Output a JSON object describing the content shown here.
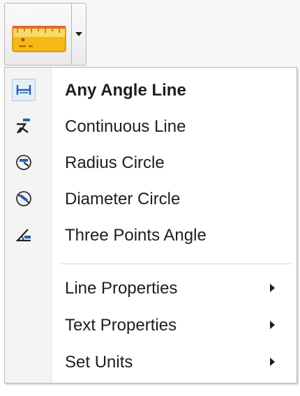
{
  "toolbar": {
    "tool_icon": "ruler-icon",
    "dropdown_icon": "chevron-down-icon"
  },
  "menu": {
    "items": [
      {
        "label": "Any Angle Line",
        "icon": "any-angle-line-icon",
        "selected": true
      },
      {
        "label": "Continuous Line",
        "icon": "continuous-line-icon"
      },
      {
        "label": "Radius Circle",
        "icon": "radius-circle-icon"
      },
      {
        "label": "Diameter Circle",
        "icon": "diameter-circle-icon"
      },
      {
        "label": "Three Points Angle",
        "icon": "three-points-angle-icon"
      }
    ],
    "submenus": [
      {
        "label": "Line Properties",
        "icon": "submenu-arrow-icon"
      },
      {
        "label": "Text Properties",
        "icon": "submenu-arrow-icon"
      },
      {
        "label": "Set Units",
        "icon": "submenu-arrow-icon"
      }
    ]
  },
  "colors": {
    "ruler_fill": "#f7c21a",
    "ruler_top": "#f8d96d",
    "ruler_edge": "#e85d2a",
    "icon_blue": "#2a5fae",
    "icon_dark": "#222222"
  }
}
